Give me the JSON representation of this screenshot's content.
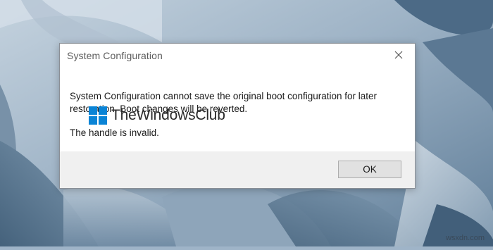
{
  "dialog": {
    "title": "System Configuration",
    "message": "System Configuration cannot save the original boot configuration for later restoration. Boot changes will be reverted.",
    "detail": "The handle is invalid.",
    "ok_label": "OK",
    "close_icon": "close-icon"
  },
  "brand": {
    "text": "TheWindowsClub",
    "logo_icon": "windows-logo-icon",
    "logo_color": "#0a84d6"
  },
  "watermark": {
    "text": "wsxdn.com"
  },
  "colors": {
    "footer": "#f0f0f0",
    "button": "#e1e1e1",
    "desktop": "#9fb4c8"
  }
}
